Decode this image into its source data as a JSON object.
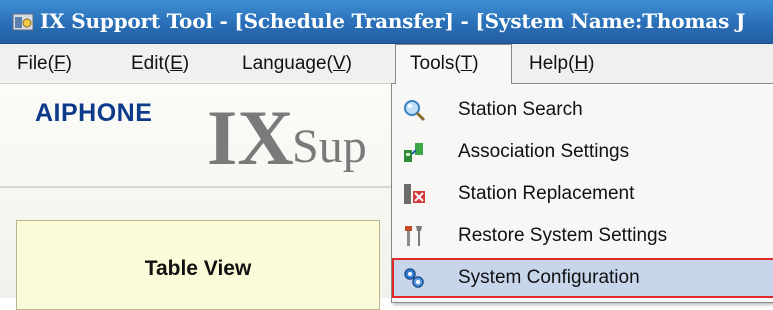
{
  "window": {
    "title": "IX Support Tool - [Schedule Transfer] - [System Name:Thomas J"
  },
  "menu": {
    "items": [
      {
        "label": "File(F)",
        "text": "File(",
        "key": "F",
        "tail": ")"
      },
      {
        "label": "Edit(E)",
        "text": "Edit(",
        "key": "E",
        "tail": ")"
      },
      {
        "label": "Language(V)",
        "text": "Language(",
        "key": "V",
        "tail": ")"
      },
      {
        "label": "Tools(T)",
        "text": "Tools(",
        "key": "T",
        "tail": ")"
      },
      {
        "label": "Help(H)",
        "text": "Help(",
        "key": "H",
        "tail": ")"
      }
    ],
    "open_menu": "Tools(T)"
  },
  "branding": {
    "company": "AIPHONE",
    "product_ix": "IX",
    "product_sup": "Sup"
  },
  "main": {
    "table_view_label": "Table View"
  },
  "tools_menu": {
    "items": [
      {
        "label": "Station Search",
        "icon": "magnifier-icon"
      },
      {
        "label": "Association Settings",
        "icon": "association-icon"
      },
      {
        "label": "Station Replacement",
        "icon": "station-replacement-icon"
      },
      {
        "label": "Restore System Settings",
        "icon": "tools-icon"
      },
      {
        "label": "System Configuration",
        "icon": "system-configuration-icon",
        "highlighted": true
      }
    ]
  },
  "colors": {
    "titlebar": "#2a6fb8",
    "brand_blue": "#0e3a8c",
    "highlight_fill": "#c8d6ec",
    "highlight_border": "#e02a2a"
  }
}
